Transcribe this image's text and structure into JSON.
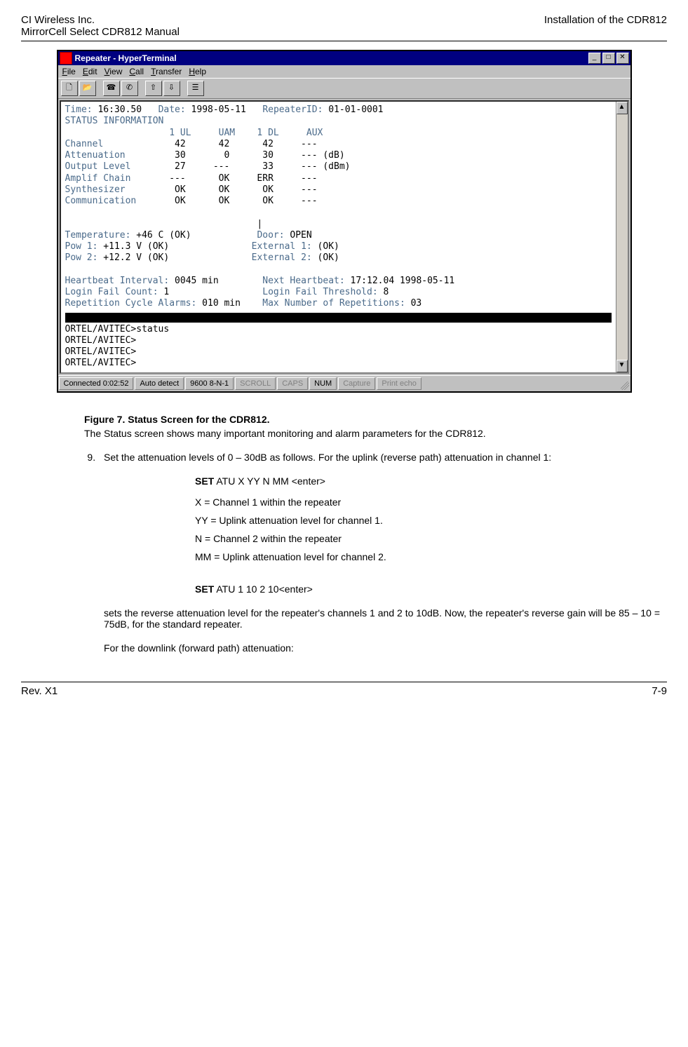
{
  "header": {
    "left_line1": "CI Wireless Inc.",
    "left_line2": "MirrorCell Select CDR812 Manual",
    "right_line1": "Installation of the CDR812"
  },
  "win": {
    "title": "Repeater - HyperTerminal",
    "min": "_",
    "max": "□",
    "close": "✕",
    "menu": {
      "file": "File",
      "edit": "Edit",
      "view": "View",
      "call": "Call",
      "transfer": "Transfer",
      "help": "Help"
    },
    "vsb": {
      "up": "▲",
      "down": "▼"
    }
  },
  "term": {
    "l_time": "Time:",
    "v_time": "16:30.50",
    "l_date": "Date:",
    "v_date": "1998-05-11",
    "l_rep": "RepeaterID:",
    "v_rep": "01-01-0001",
    "status_info": "STATUS INFORMATION",
    "hdr": "                   1 UL     UAM    1 DL     AUX",
    "r_channel_l": "Channel",
    "r_channel_v": "             42      42      42     ---",
    "r_att_l": "Attenuation",
    "r_att_v": "         30       0      30     --- (dB)",
    "r_out_l": "Output Level",
    "r_out_v": "        27     ---      33     --- (dBm)",
    "r_amp_l": "Amplif Chain",
    "r_amp_v": "       ---      OK     ERR     ---",
    "r_syn_l": "Synthesizer",
    "r_syn_v": "         OK      OK      OK     ---",
    "r_com_l": "Communication",
    "r_com_v": "       OK      OK      OK     ---",
    "cursor": "                                   |",
    "l_temp": "Temperature:",
    "v_temp": " +46 C (OK)",
    "sp_temp": "            ",
    "l_door": "Door:",
    "v_door": " OPEN",
    "l_pow1": "Pow 1:",
    "v_pow1": " +11.3 V (OK)",
    "sp_pow1": "               ",
    "l_ext1": "External 1:",
    "v_ext1": " (OK)",
    "l_pow2": "Pow 2:",
    "v_pow2": " +12.2 V (OK)",
    "sp_pow2": "               ",
    "l_ext2": "External 2:",
    "v_ext2": " (OK)",
    "l_hb": "Heartbeat Interval:",
    "v_hb": " 0045 min",
    "sp_hb": "        ",
    "l_nhb": "Next Heartbeat:",
    "v_nhb": " 17:12.04 1998-05-11",
    "l_lfc": "Login Fail Count:",
    "v_lfc": " 1",
    "sp_lfc": "                 ",
    "l_lft": "Login Fail Threshold:",
    "v_lft": " 8",
    "l_rca": "Repetition Cycle Alarms:",
    "v_rca": " 010 min",
    "sp_rca": "    ",
    "l_mnr": "Max Number of Repetitions:",
    "v_mnr": " 03",
    "p1": "ORTEL/AVITEC>status",
    "p2": "ORTEL/AVITEC>",
    "p3": "ORTEL/AVITEC>",
    "p4": "ORTEL/AVITEC>"
  },
  "status": {
    "connected": "Connected 0:02:52",
    "detect": "Auto detect",
    "setting": "9600 8-N-1",
    "scroll": "SCROLL",
    "caps": "CAPS",
    "num": "NUM",
    "capture": "Capture",
    "echo": "Print echo"
  },
  "doc": {
    "fig_caption": "Figure 7. Status Screen for the CDR812.",
    "fig_desc": "The Status screen shows many important monitoring and alarm parameters for the CDR812.",
    "step9": "Set the attenuation levels of 0 – 30dB as follows. For the uplink (reverse path) attenuation in channel 1:",
    "cmd1_b": "SET",
    "cmd1_rest": " ATU X YY N MM <enter>",
    "x": "X = Channel 1 within the repeater",
    "yy": "YY = Uplink attenuation level for channel 1.",
    "n": "N = Channel 2 within the repeater",
    "mm": "MM = Uplink attenuation level for channel 2.",
    "cmd2_b": "SET",
    "cmd2_rest": " ATU 1 10 2 10<enter>",
    "para2": "sets the reverse attenuation level for the repeater's channels 1 and 2 to 10dB. Now, the repeater's reverse gain will be 85 – 10 = 75dB, for the standard repeater.",
    "para3": "For the downlink (forward path) attenuation:"
  },
  "footer": {
    "left": "Rev. X1",
    "right": "7-9"
  }
}
